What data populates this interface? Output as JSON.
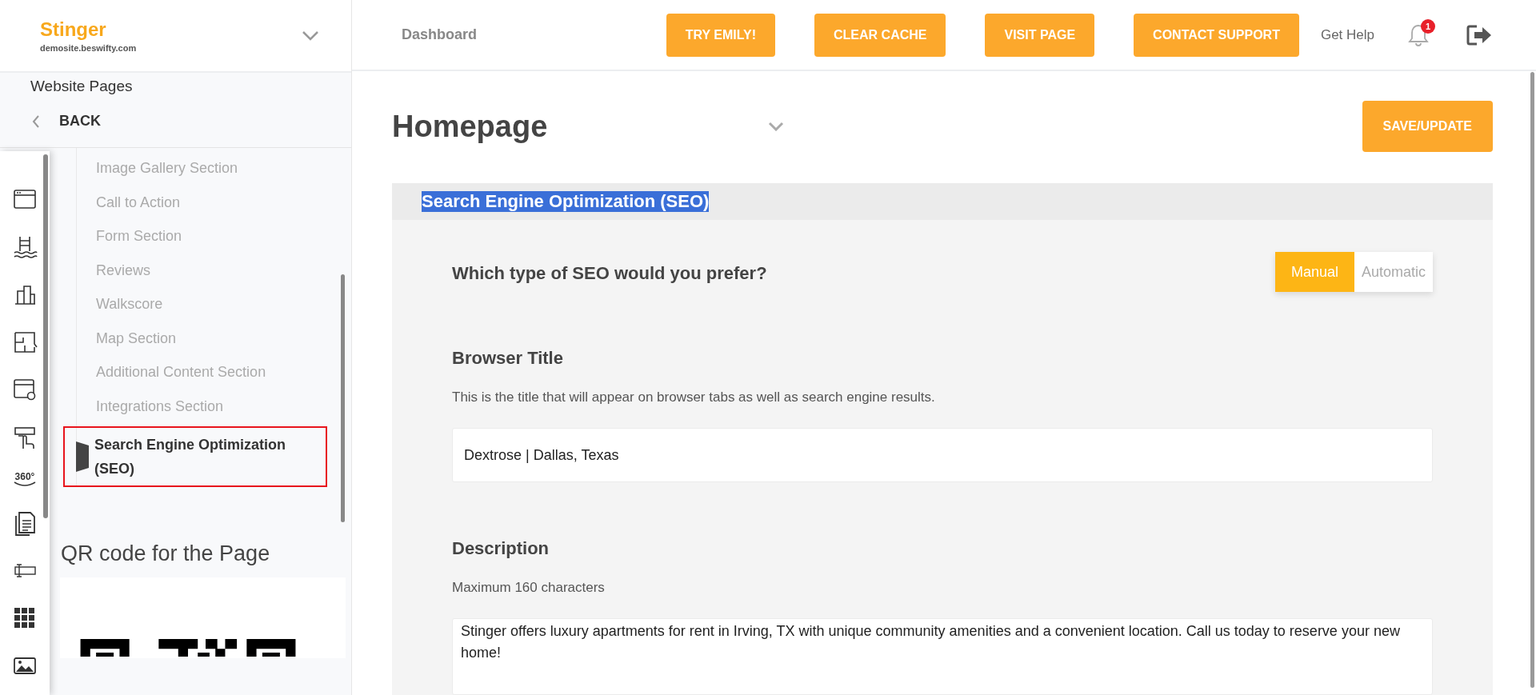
{
  "brand": {
    "site_name": "Stinger",
    "site_url": "demosite.beswifty.com"
  },
  "top_bar": {
    "dashboard_link": "Dashboard",
    "buttons": [
      "TRY EMILY!",
      "CLEAR CACHE",
      "VISIT PAGE",
      "CONTACT SUPPORT"
    ],
    "help_link": "Get Help",
    "notification_count": "1"
  },
  "sidebar": {
    "title": "Website Pages",
    "back_label": "BACK",
    "rail_360_label": "360°",
    "sections": [
      {
        "label": "Image Gallery Section",
        "selected": false
      },
      {
        "label": "Call to Action",
        "selected": false
      },
      {
        "label": "Form Section",
        "selected": false
      },
      {
        "label": "Reviews",
        "selected": false
      },
      {
        "label": "Walkscore",
        "selected": false
      },
      {
        "label": "Map Section",
        "selected": false
      },
      {
        "label": "Additional Content Section",
        "selected": false
      },
      {
        "label": "Integrations Section",
        "selected": false
      },
      {
        "label": "Search Engine Optimization (SEO)",
        "selected": true
      }
    ],
    "qr_heading": "QR code for the Page"
  },
  "page": {
    "title": "Homepage",
    "save_button": "SAVE/UPDATE",
    "section_heading": "Search Engine Optimization (SEO)",
    "seo_question": "Which type of SEO would you prefer?",
    "seo_types": [
      {
        "label": "Manual",
        "selected": true
      },
      {
        "label": "Automatic",
        "selected": false
      }
    ],
    "browser_title": {
      "label": "Browser Title",
      "hint": "This is the title that will appear on browser tabs as well as search engine results.",
      "value": "Dextrose | Dallas, Texas"
    },
    "description": {
      "label": "Description",
      "hint": "Maximum 160 characters",
      "value": "Stinger offers luxury apartments for rent in Irving, TX with unique community amenities and a convenient location. Call us today to reserve your new home!"
    }
  }
}
